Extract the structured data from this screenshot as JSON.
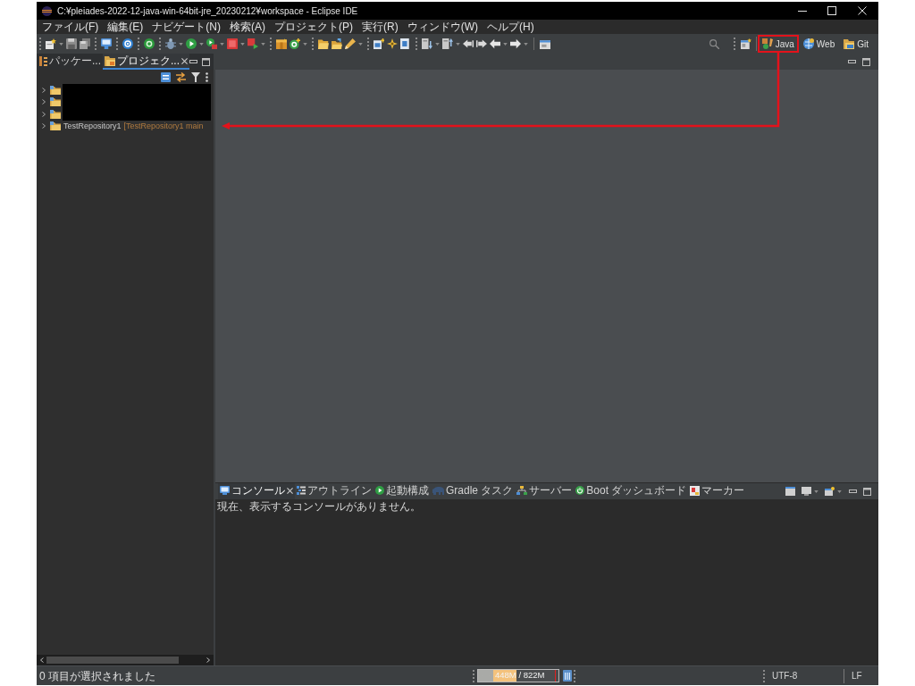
{
  "window": {
    "title": "C:¥pleiades-2022-12-java-win-64bit-jre_20230212¥workspace - Eclipse IDE"
  },
  "menu": [
    "ファイル(F)",
    "編集(E)",
    "ナビゲート(N)",
    "検索(A)",
    "プロジェクト(P)",
    "実行(R)",
    "ウィンドウ(W)",
    "ヘルプ(H)"
  ],
  "perspectives": [
    {
      "label": "Java",
      "highlighted": true
    },
    {
      "label": "Web",
      "highlighted": false
    },
    {
      "label": "Git",
      "highlighted": false
    }
  ],
  "left_panel": {
    "focused": true,
    "tabs": [
      {
        "label": "パッケー...",
        "selected": false
      },
      {
        "label": "プロジェク...",
        "selected": true
      }
    ]
  },
  "tree": [
    {
      "kind": "redacted",
      "expanded": false
    },
    {
      "kind": "redacted",
      "expanded": false
    },
    {
      "kind": "redacted",
      "expanded": false
    },
    {
      "kind": "project",
      "name": "TestRepository1",
      "decoration": "[TestRepository1 main",
      "expanded": false,
      "pointed_at": true
    }
  ],
  "bottom_panel": {
    "focused": false,
    "tabs": [
      {
        "label": "コンソール",
        "selected": true
      },
      {
        "label": "アウトライン",
        "selected": false
      },
      {
        "label": "起動構成",
        "selected": false
      },
      {
        "label": "Gradle タスク",
        "selected": false
      },
      {
        "label": "サーバー",
        "selected": false
      },
      {
        "label": "Boot ダッシュボード",
        "selected": false
      },
      {
        "label": "マーカー",
        "selected": false
      }
    ],
    "message": "現在、表示するコンソールがありません。"
  },
  "status_bar": {
    "selection": "0 項目が選択されました",
    "heap": {
      "reading": "448M / 822M",
      "level": 0.48
    },
    "encoding": "UTF-8",
    "line_delimiter": "LF"
  }
}
